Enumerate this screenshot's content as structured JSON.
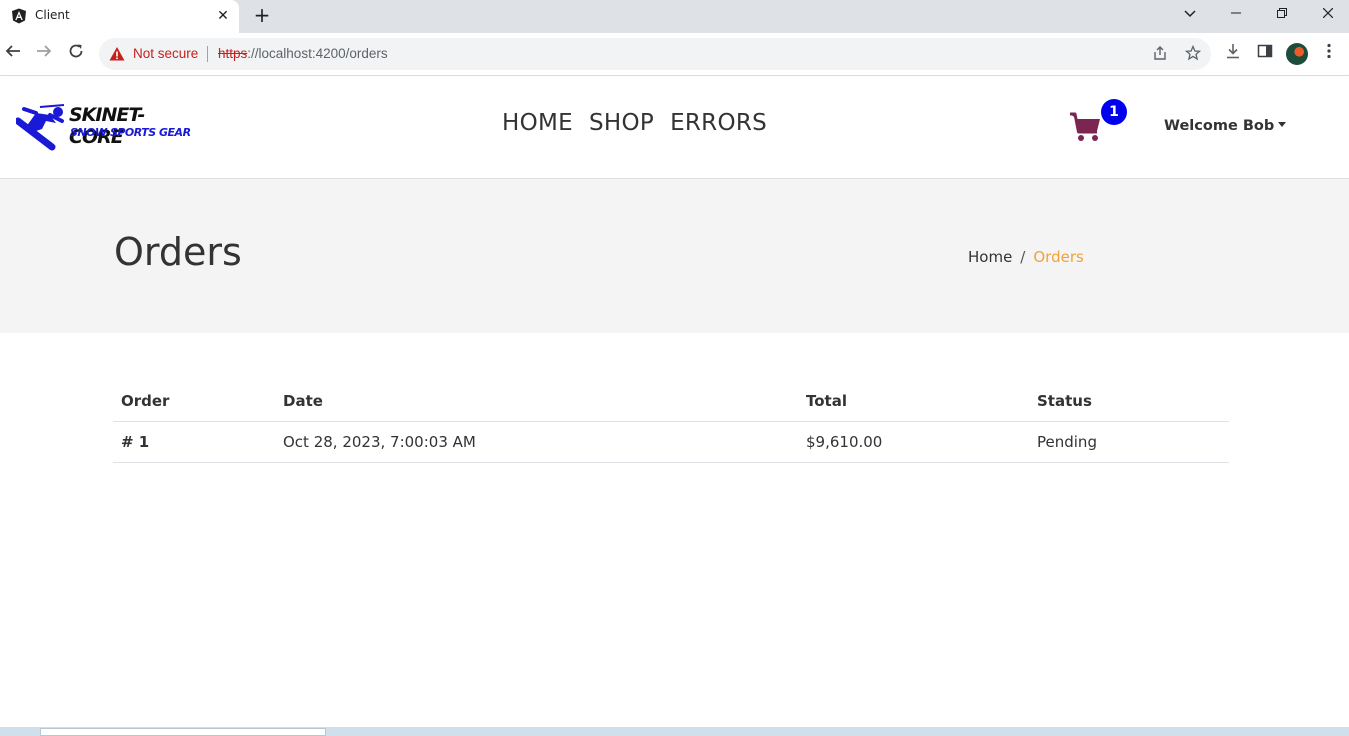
{
  "browser": {
    "tab_title": "Client",
    "security_label": "Not secure",
    "url_scheme": "https",
    "url_rest": "://localhost:4200/orders"
  },
  "site": {
    "logo_title": "SKINET-CORE",
    "logo_subtitle": "SNOW SPORTS GEAR",
    "nav": [
      "HOME",
      "SHOP",
      "ERRORS"
    ],
    "cart_count": "1",
    "welcome": "Welcome Bob",
    "brand_color": "#1a1ad6",
    "cart_color": "#7b2550",
    "accent_color": "#f0a33a"
  },
  "page": {
    "title": "Orders",
    "breadcrumb_home": "Home",
    "breadcrumb_current": "Orders"
  },
  "table": {
    "headers": [
      "Order",
      "Date",
      "Total",
      "Status"
    ],
    "rows": [
      {
        "order": "# 1",
        "date": "Oct 28, 2023, 7:00:03 AM",
        "total": "$9,610.00",
        "status": "Pending"
      }
    ]
  }
}
